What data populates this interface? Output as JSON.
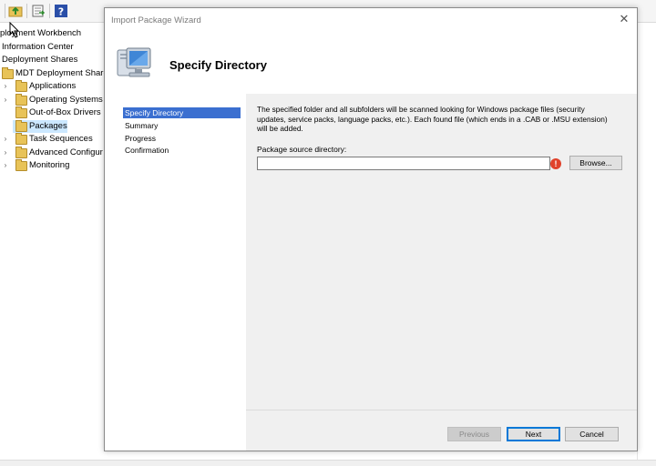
{
  "mmc": {
    "tree": [
      {
        "label": "ployment Workbench"
      },
      {
        "label": "Information Center"
      },
      {
        "label": "Deployment Shares"
      },
      {
        "label": "MDT Deployment Share"
      },
      {
        "label": "Applications"
      },
      {
        "label": "Operating Systems"
      },
      {
        "label": "Out-of-Box Drivers"
      },
      {
        "label": "Packages"
      },
      {
        "label": "Task Sequences"
      },
      {
        "label": "Advanced Configur"
      },
      {
        "label": "Monitoring"
      }
    ]
  },
  "wizard": {
    "title": "Import Package Wizard",
    "heading": "Specify Directory",
    "steps": [
      "Specify Directory",
      "Summary",
      "Progress",
      "Confirmation"
    ],
    "active_step": "Specify Directory",
    "description": "The specified folder and all subfolders will be scanned looking for Windows package files (security updates, service packs, language packs, etc.).  Each found file (which ends in a .CAB or .MSU extension) will be added.",
    "source_label": "Package source directory:",
    "source_value": "",
    "error_glyph": "!",
    "browse_label": "Browse...",
    "buttons": {
      "previous": "Previous",
      "next": "Next",
      "cancel": "Cancel"
    }
  }
}
